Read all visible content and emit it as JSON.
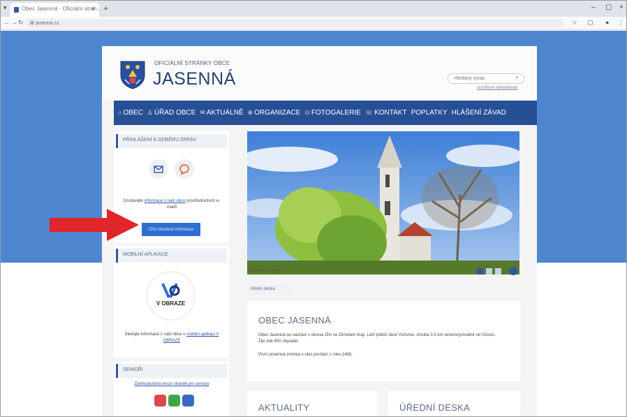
{
  "browser": {
    "tab_title": "Obec Jasenná - Oficiální strán...",
    "url": "jasenna.cz",
    "tab_menu_icon": "chevron-down-icon",
    "controls": [
      "–",
      "▢",
      "×"
    ]
  },
  "header": {
    "subtitle": "OFICIÁLNÍ STRÁNKY OBCE",
    "title": "JASENNÁ",
    "search_placeholder": "Hledaný výraz",
    "search_advanced": "rozšířené vyhledávání"
  },
  "menu": [
    {
      "icon": "⌂",
      "label": "OBEC"
    },
    {
      "icon": "♙",
      "label": "ÚŘAD OBCE"
    },
    {
      "icon": "✉",
      "label": "AKTUÁLNĚ"
    },
    {
      "icon": "⊕",
      "label": "ORGANIZACE"
    },
    {
      "icon": "⊙",
      "label": "FOTOGALERIE"
    },
    {
      "icon": "☏",
      "label": "KONTAKT"
    },
    {
      "icon": "",
      "label": "POPLATKY"
    },
    {
      "icon": "",
      "label": "HLÁŠENÍ ZÁVAD"
    }
  ],
  "sidebar": {
    "subscribe": {
      "heading": "PŘIHLÁŠENÍ K ODBĚRU ZPRÁV",
      "text_before": "Dostávejte ",
      "text_link": "informace z naší obce",
      "text_after": " prostřednictvím e-mailů",
      "button": "Chci dostávat informace"
    },
    "app": {
      "heading": "MOBILNÍ APLIKACE",
      "logo_text": "V OBRAZE",
      "text_before": "Sledujte informace z naší obce v ",
      "text_link": "mobilní aplikaci V OBRAZE"
    },
    "seniors": {
      "heading": "SENIOŘI",
      "text_link": "Zjednodušená verze stránek pro seniory"
    }
  },
  "hero": {
    "more_link": "Zobrazit všechny »",
    "tag": "úřední deska"
  },
  "intro": {
    "title": "OBEC JASENNÁ",
    "p1": "Obec Jasenná se nachází v okrese Zlín ve Zlínském kraji. Leží poblíž obce Vizovice, zhruba 3,5 km severovýchodně od Vizovic. Žije zde 800 obyvatel.",
    "p2": "První písemná zmínka o obci pochází z roku 1468."
  },
  "news": {
    "left_title": "AKTUALITY",
    "right_title": "ÚŘEDNÍ DESKA"
  },
  "colors": {
    "page_blue": "#4d86cf",
    "menu_blue": "#264f95",
    "button_blue": "#2e6fd0",
    "arrow_red": "#e0262a"
  }
}
